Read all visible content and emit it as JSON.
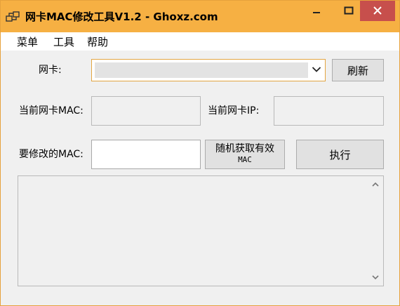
{
  "window": {
    "title": "网卡MAC修改工具V1.2 - Ghoxz.com",
    "icon": "network-adapter-icon",
    "controls": [
      "minimize-icon",
      "maximize-icon",
      "close-icon"
    ],
    "colors": {
      "titlebar": "#f6b043",
      "close": "#c74f4c",
      "focus_border": "#e3a542"
    }
  },
  "menu": {
    "items": [
      {
        "label": "菜单"
      },
      {
        "label": "工具"
      },
      {
        "label": "帮助"
      }
    ]
  },
  "form": {
    "adapter_label": "网卡:",
    "adapter_value": "",
    "refresh_label": "刷新",
    "current_mac_label": "当前网卡MAC:",
    "current_mac_value": "",
    "current_ip_label": "当前网卡IP:",
    "current_ip_value": "",
    "new_mac_label": "要修改的MAC:",
    "new_mac_value": "",
    "random_btn_line1": "随机获取有效",
    "random_btn_line2": "MAC",
    "execute_label": "执行",
    "output_text": ""
  }
}
